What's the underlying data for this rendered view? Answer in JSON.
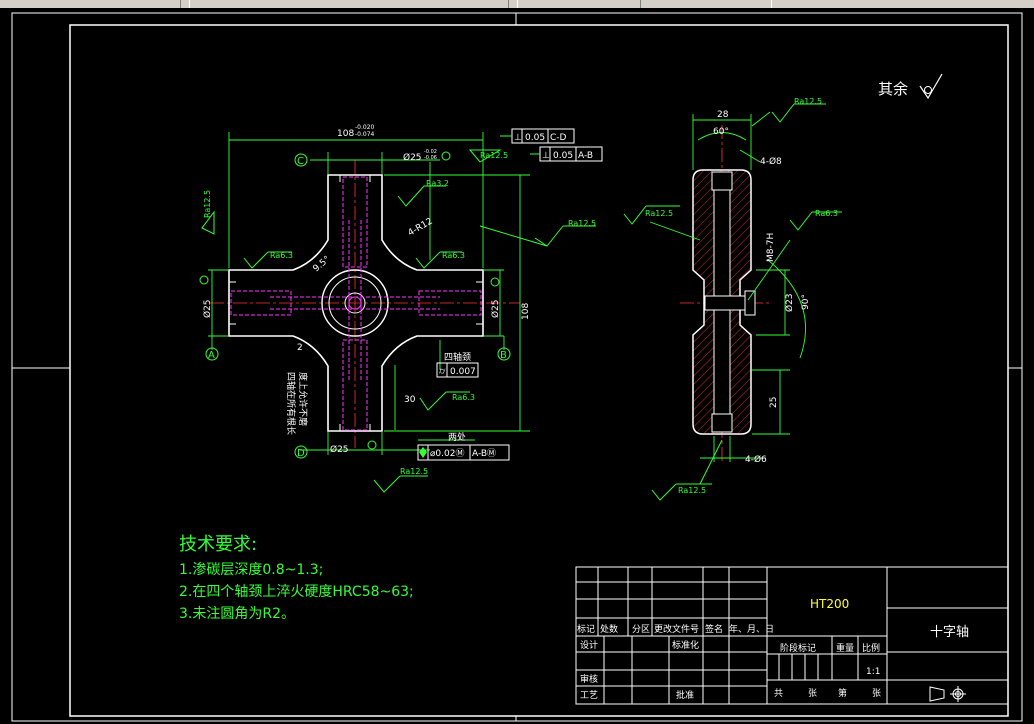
{
  "surface_finish_other": "其余",
  "tech_requirements": {
    "title": "技术要求:",
    "items": [
      "1.渗碳层深度0.8~1.3;",
      "2.在四个轴颈上淬火硬度HRC58~63;",
      "3.未注圆角为R2。"
    ]
  },
  "front_view": {
    "dim_overall": "108",
    "dim_overall_tol_upper": "-0.020",
    "dim_overall_tol_lower": "-0.074",
    "dim_overall_v": "108",
    "journal_dia": "Ø25",
    "journal_dia_tol_upper": "-0.02",
    "journal_dia_tol_lower": "-0.06",
    "side_journal_tol": "-0.02 -0.06",
    "fillet": "4-R12",
    "angle": "9.5°",
    "dim_2": "2",
    "dim_30": "30",
    "four_journals_note": "四轴颈",
    "both_sides_note": "两处",
    "vertical_note_1": "四轴在所有根长",
    "vertical_note_2": "度上允许不磨",
    "datum_a": "A",
    "datum_b": "B",
    "datum_c": "C",
    "datum_d": "D",
    "datum_e": "E",
    "rough_ra125": "Ra12.5",
    "rough_ra63": "Ra6.3",
    "rough_ra32": "Ra3.2",
    "fcf_1_sym": "⊥",
    "fcf_1_val": "0.05",
    "fcf_1_datum": "C-D",
    "fcf_2_sym": "⊥",
    "fcf_2_val": "0.05",
    "fcf_2_datum": "A-B",
    "fcf_3_sym": "⌭",
    "fcf_3_val": "0.007",
    "fcf_4_val": "⌀0.02Ⓜ",
    "fcf_4_datum": "A-BⓂ"
  },
  "side_view": {
    "dim_28": "28",
    "angle_60": "60°",
    "holes_top": "4-Ø8",
    "thread": "M8-7H",
    "dia_23": "Ø23",
    "angle_90": "90°",
    "dim_25": "25",
    "holes_bottom": "4-Ø6",
    "rough_ra125": "Ra12.5",
    "rough_ra63": "Ra6.3"
  },
  "title_block": {
    "material": "HT200",
    "part_name": "十字轴",
    "scale": "1:1",
    "h_mark": "标记",
    "h_count": "处数",
    "h_zone": "分区",
    "h_doc": "更改文件号",
    "h_sign": "签名",
    "h_date": "年、月、日",
    "r_design": "设计",
    "r_std": "标准化",
    "r_stage": "阶段标记",
    "r_weight": "重量",
    "r_scale": "比例",
    "r_review": "审核",
    "r_process": "工艺",
    "r_approve": "批准",
    "sheet_total": "共",
    "sheet_unit": "张",
    "sheet_no": "第",
    "sheet_unit2": "张"
  }
}
